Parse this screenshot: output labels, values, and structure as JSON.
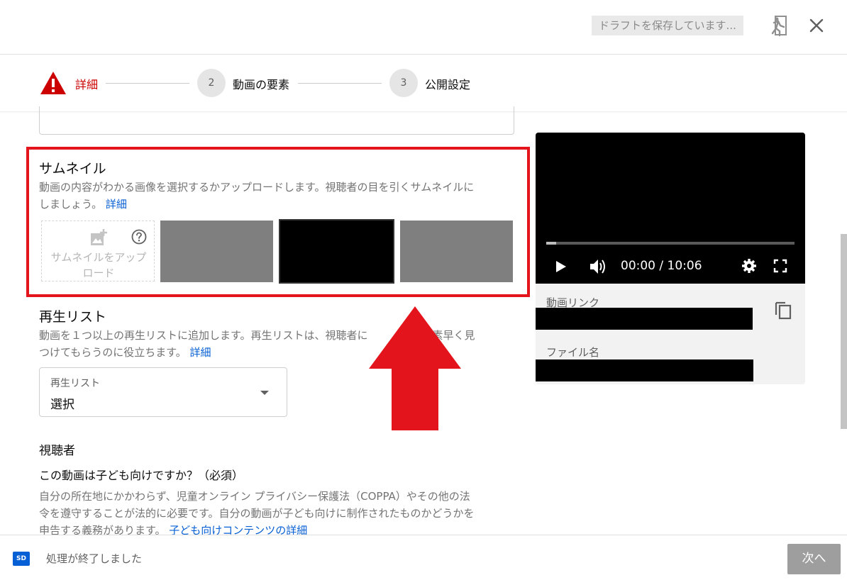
{
  "header": {
    "draft_status": "ドラフトを保存しています..."
  },
  "stepper": {
    "steps": [
      {
        "number": "",
        "label": "詳細",
        "state": "error"
      },
      {
        "number": "2",
        "label": "動画の要素"
      },
      {
        "number": "3",
        "label": "公開設定"
      }
    ]
  },
  "thumbnail": {
    "title": "サムネイル",
    "desc_line1": "動画の内容がわかる画像を選択するかアップロードします。視聴者の目を引くサムネイルに",
    "desc_line2": "しましょう。",
    "learn_more": "詳細",
    "upload_line1": "サムネイルをアップ",
    "upload_line2": "ロード"
  },
  "playlist": {
    "title": "再生リスト",
    "desc_line1_a": "動画を１つ以上の再生リストに追加します。再生リストは、視聴者に",
    "desc_line1_b": "ンツを素早く見",
    "desc_line2": "つけてもらうのに役立ちます。",
    "learn_more": "詳細",
    "select_label": "再生リスト",
    "select_value": "選択"
  },
  "audience": {
    "title": "視聴者",
    "question": "この動画は子ども向けですか？（必須）",
    "desc_line1": "自分の所在地にかかわらず、児童オンライン プライバシー保護法（COPPA）やその他の法",
    "desc_line2": "令を遵守することが法的に必要です。自分の動画が子ども向けに制作されたものかどうかを",
    "desc_line3": "申告する義務があります。",
    "learn_more": "子ども向けコンテンツの詳細"
  },
  "preview": {
    "time": "00:00 / 10:06",
    "progress": 0.04,
    "video_link_label": "動画リンク",
    "filename_label": "ファイル名"
  },
  "footer": {
    "badge": "SD",
    "status": "処理が終了しました",
    "next_label": "次へ"
  },
  "colors": {
    "highlight": "#e4141c",
    "error": "#cc0000",
    "link": "#065fd4",
    "disabled_button": "#9e9e9e"
  }
}
